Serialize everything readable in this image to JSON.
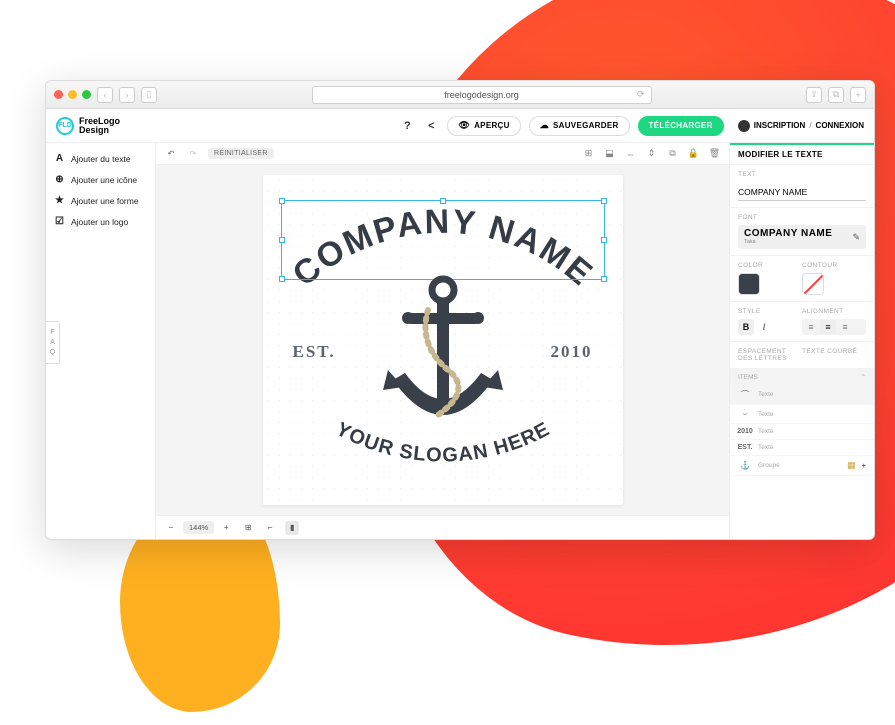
{
  "browser": {
    "url": "freelogodesign.org"
  },
  "brand": {
    "badge": "FLD",
    "line1": "FreeLogo",
    "line2": "Design"
  },
  "header": {
    "preview": "APERÇU",
    "save": "SAUVEGARDER",
    "download": "TÉLÉCHARGER",
    "signup": "INSCRIPTION",
    "login": "CONNEXION"
  },
  "sidebar": {
    "items": [
      {
        "icon": "A",
        "label": "Ajouter du texte"
      },
      {
        "icon": "⊕",
        "label": "Ajouter une icône"
      },
      {
        "icon": "★",
        "label": "Ajouter une forme"
      },
      {
        "icon": "☑",
        "label": "Ajouter un logo"
      }
    ]
  },
  "faq": "FAQ",
  "canvasToolbar": {
    "reset": "RÉINITIALISER"
  },
  "bottom": {
    "zoom": "144%"
  },
  "logo": {
    "company": "COMPANY NAME",
    "est": "EST.",
    "year": "2010",
    "slogan": "YOUR SLOGAN HERE"
  },
  "panel": {
    "title": "MODIFIER LE TEXTE",
    "text_label": "TEXT",
    "text_value": "COMPANY NAME",
    "font_label": "FONT",
    "font_name": "COMPANY NAME",
    "font_sub": "Taka",
    "color_label": "COLOR",
    "contour_label": "CONTOUR",
    "style_label": "STYLE",
    "align_label": "ALIGNMENT",
    "spacing_label": "ESPACEMENT DES LETTRES",
    "curve_label": "TEXTE COURBÉ",
    "items_label": "ITEMS",
    "items": [
      {
        "icon": "⌒",
        "type": "Texte"
      },
      {
        "icon": "⌣",
        "type": "Texte"
      },
      {
        "icon": "2010",
        "type": "Texte"
      },
      {
        "icon": "EST.",
        "type": "Texte"
      },
      {
        "icon": "⚓",
        "type": "Groupe"
      }
    ]
  }
}
